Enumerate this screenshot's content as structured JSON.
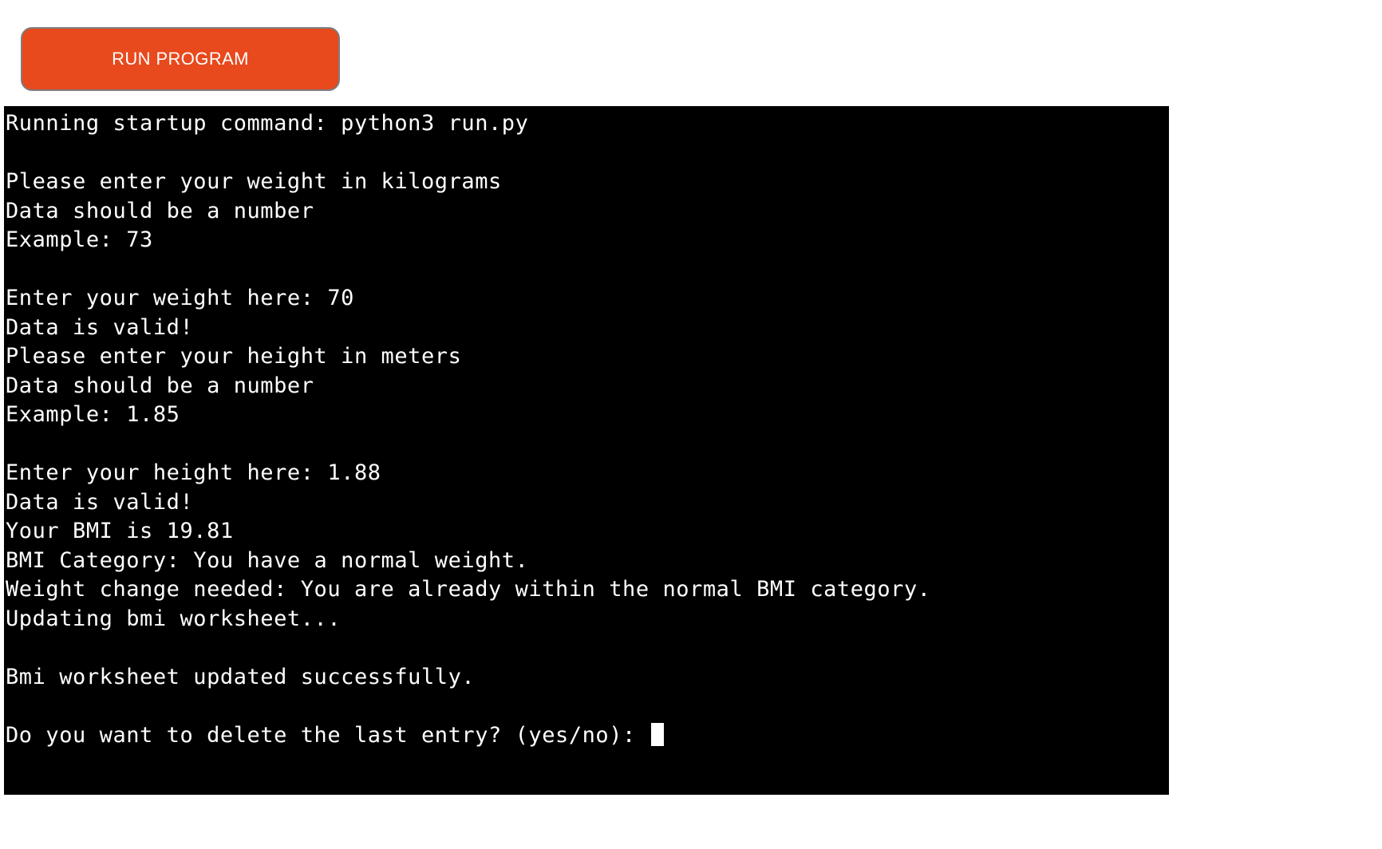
{
  "page": {
    "background_color": "#ffffff"
  },
  "toolbar": {
    "run_button_label": "RUN PROGRAM",
    "run_button_color": "#e8491d",
    "run_button_text_color": "#ffffff",
    "run_button_border_color": "#7d7d7d"
  },
  "terminal": {
    "background_color": "#000000",
    "text_color": "#ffffff",
    "cursor": "block",
    "lines": [
      "Running startup command: python3 run.py",
      "",
      "Please enter your weight in kilograms",
      "Data should be a number",
      "Example: 73",
      "",
      "Enter your weight here: 70",
      "Data is valid!",
      "Please enter your height in meters",
      "Data should be a number",
      "Example: 1.85",
      "",
      "Enter your height here: 1.88",
      "Data is valid!",
      "Your BMI is 19.81",
      "BMI Category: You have a normal weight.",
      "Weight change needed: You are already within the normal BMI category.",
      "Updating bmi worksheet...",
      "",
      "Bmi worksheet updated successfully.",
      "",
      "Do you want to delete the last entry? (yes/no): "
    ],
    "values": {
      "startup_command": "python3 run.py",
      "weight_example": "73",
      "weight_entered": "70",
      "height_example": "1.85",
      "height_entered": "1.88",
      "bmi": "19.81",
      "bmi_category": "You have a normal weight.",
      "weight_change": "You are already within the normal BMI category.",
      "worksheet_name": "bmi",
      "prompt_options": "(yes/no)"
    }
  }
}
